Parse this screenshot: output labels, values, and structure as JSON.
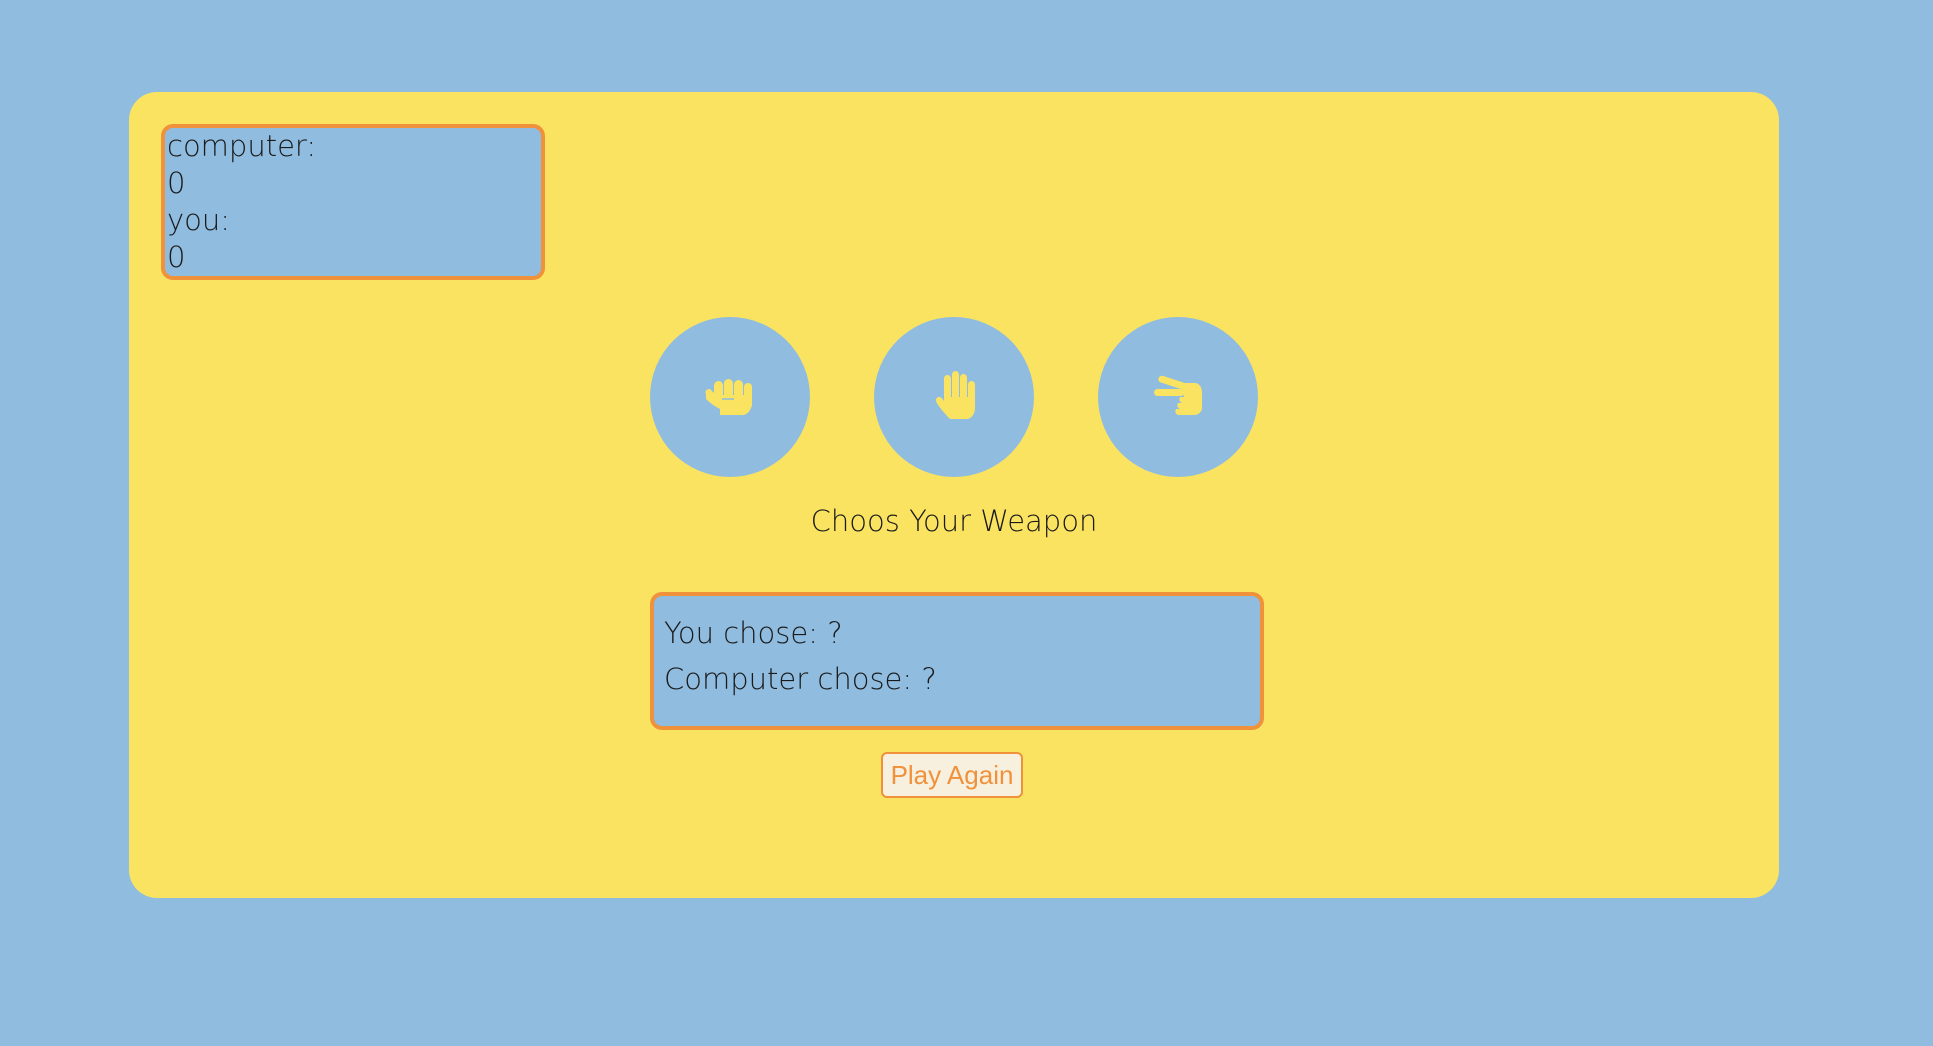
{
  "scoreboard": {
    "computer_label": "computer:",
    "computer_score": "0",
    "you_label": "you:",
    "you_score": "0"
  },
  "weapons": [
    {
      "name": "rock",
      "icon": "fist-icon"
    },
    {
      "name": "paper",
      "icon": "open-hand-icon"
    },
    {
      "name": "scissors",
      "icon": "peace-hand-icon"
    }
  ],
  "prompt": "Choos Your Weapon",
  "results": {
    "you_chose_label": "You chose:",
    "you_chose_value": "?",
    "computer_chose_label": "Computer chose:",
    "computer_chose_value": "?"
  },
  "play_again_label": "Play Again",
  "colors": {
    "background": "#8fbcdf",
    "card": "#fbe362",
    "accent": "#f0913b",
    "icon": "#fbe362"
  }
}
